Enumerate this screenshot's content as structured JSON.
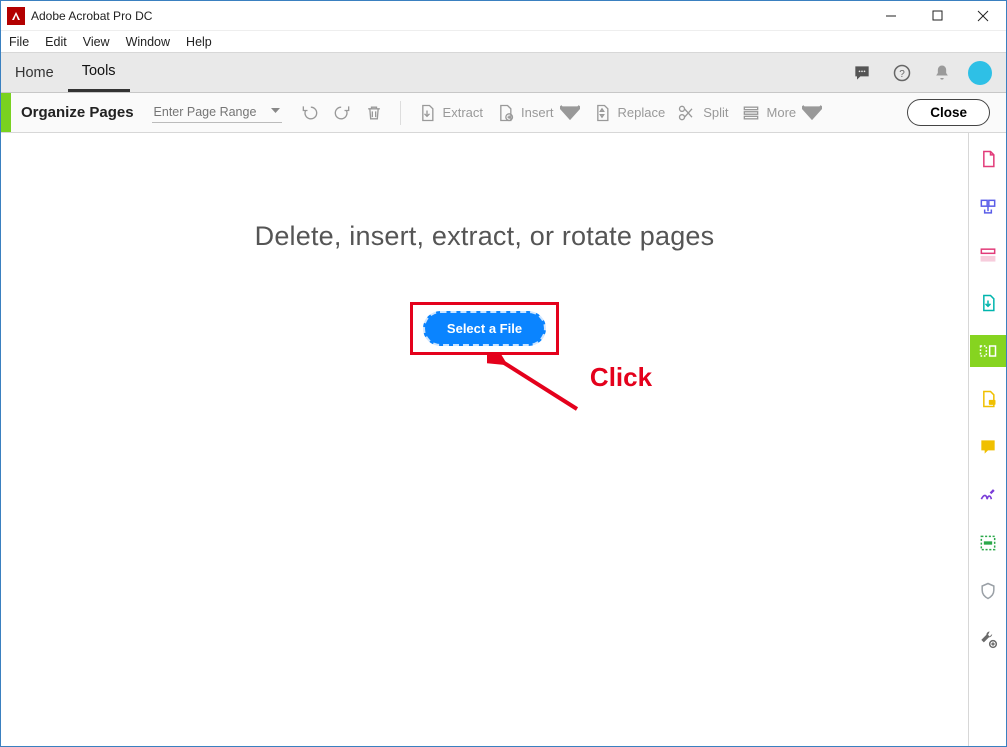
{
  "title": "Adobe Acrobat Pro DC",
  "menubar": [
    "File",
    "Edit",
    "View",
    "Window",
    "Help"
  ],
  "tabs": {
    "home": "Home",
    "tools": "Tools",
    "active": "tools"
  },
  "ribbon": {
    "label": "Organize Pages",
    "page_range_placeholder": "Enter Page Range",
    "extract": "Extract",
    "insert": "Insert",
    "replace": "Replace",
    "split": "Split",
    "more": "More",
    "close": "Close"
  },
  "main": {
    "hint": "Delete, insert, extract, or rotate pages",
    "select_file": "Select a File"
  },
  "annotation": {
    "label": "Click"
  },
  "right_tools": [
    {
      "name": "create-pdf",
      "color": "#e23b79"
    },
    {
      "name": "combine-files",
      "color": "#5a5de8"
    },
    {
      "name": "edit-pdf",
      "color": "#e23b79"
    },
    {
      "name": "export-pdf",
      "color": "#00b5ad"
    },
    {
      "name": "organize-pages",
      "color": "#ffffff",
      "active": true
    },
    {
      "name": "comment-pdf",
      "color": "#f0c000"
    },
    {
      "name": "sticky-note",
      "color": "#f0c000"
    },
    {
      "name": "sign",
      "color": "#7a3dd8"
    },
    {
      "name": "redact",
      "color": "#2aa84a"
    },
    {
      "name": "protect",
      "color": "#9aa0a6"
    },
    {
      "name": "more-tools",
      "color": "#6a6a6a"
    }
  ]
}
